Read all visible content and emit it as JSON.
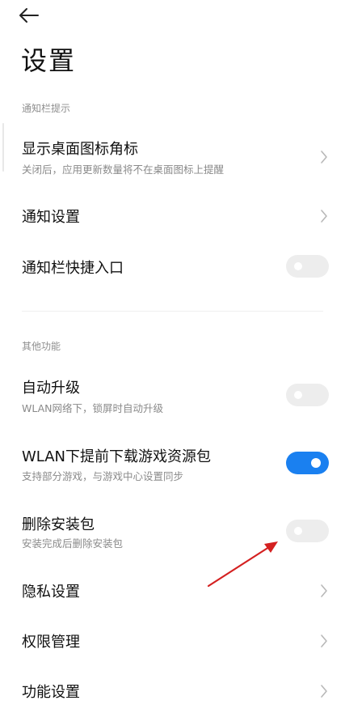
{
  "header": {
    "back_icon": "arrow-left-icon",
    "title": "设置"
  },
  "sections": {
    "notification": {
      "label": "通知栏提示"
    },
    "other": {
      "label": "其他功能"
    }
  },
  "rows": {
    "badge": {
      "title": "显示桌面图标角标",
      "subtitle": "关闭后，应用更新数量将不在桌面图标上提醒",
      "control": "chevron-right-icon"
    },
    "notify_settings": {
      "title": "通知设置",
      "control": "chevron-right-icon"
    },
    "notify_shortcut": {
      "title": "通知栏快捷入口",
      "toggle_on": false
    },
    "auto_upgrade": {
      "title": "自动升级",
      "subtitle": "WLAN网络下，锁屏时自动升级",
      "toggle_on": false
    },
    "predownload": {
      "title": "WLAN下提前下载游戏资源包",
      "subtitle": "支持部分游戏，与游戏中心设置同步",
      "toggle_on": true
    },
    "delete_package": {
      "title": "删除安装包",
      "subtitle": "安装完成后删除安装包",
      "toggle_on": false
    },
    "privacy": {
      "title": "隐私设置",
      "control": "chevron-right-icon"
    },
    "permissions": {
      "title": "权限管理",
      "control": "chevron-right-icon"
    },
    "features": {
      "title": "功能设置",
      "control": "chevron-right-icon"
    }
  },
  "colors": {
    "accent": "#1a80f0",
    "toggle_off": "#ededed",
    "annotation_arrow": "#d42020",
    "subtitle": "#8a8a8a"
  }
}
